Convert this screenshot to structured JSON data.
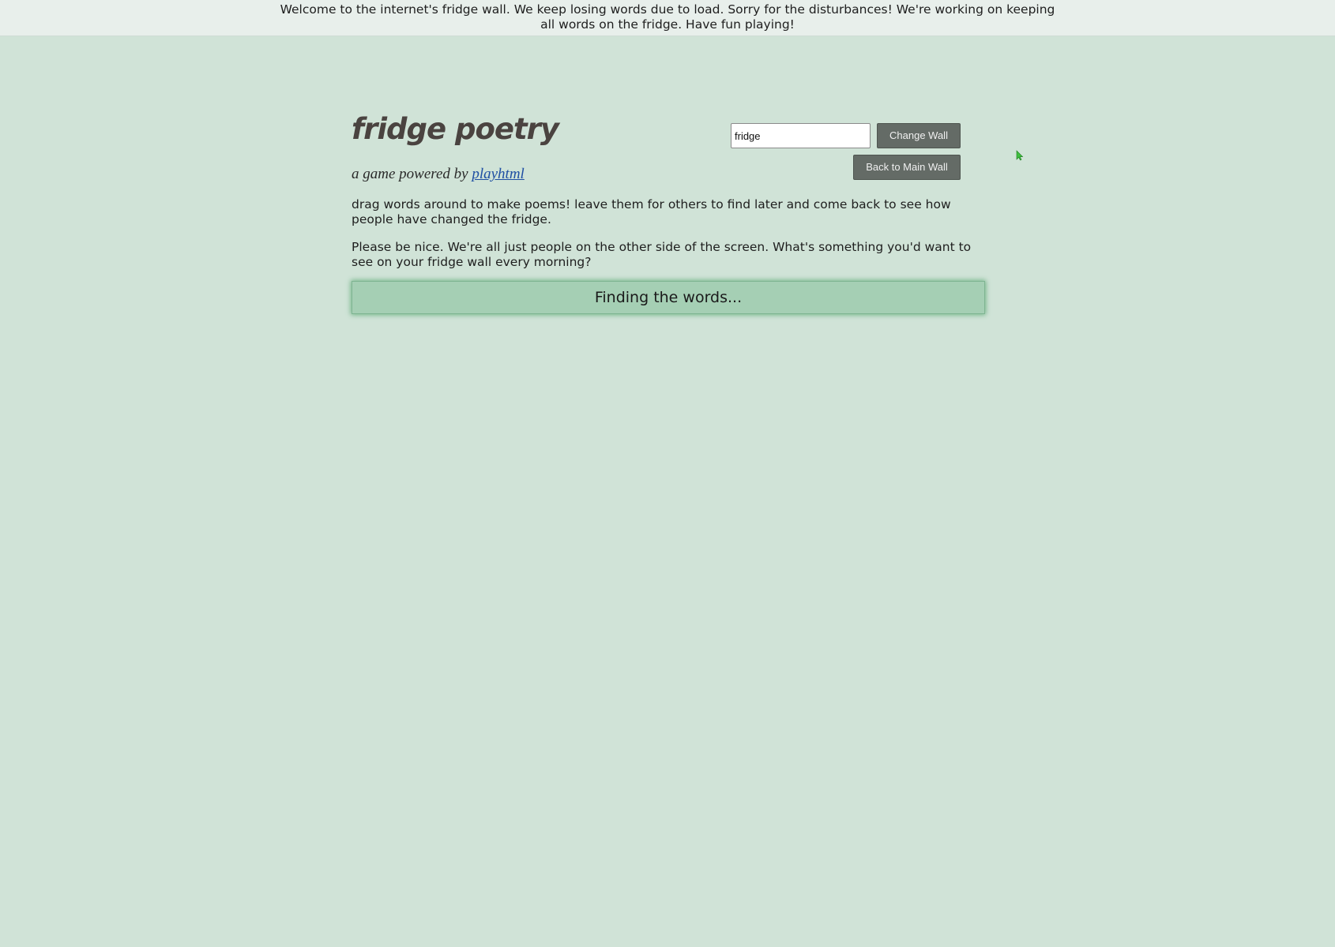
{
  "banner": {
    "message": "Welcome to the internet's fridge wall. We keep losing words due to load. Sorry for the disturbances! We're working on keeping all words on the fridge. Have fun playing!"
  },
  "header": {
    "title": "fridge poetry",
    "subtitle_prefix": "a game powered by",
    "subtitle_link": "playhtml"
  },
  "wall_controls": {
    "wall_name_value": "fridge",
    "change_wall_label": "Change Wall",
    "back_to_main_label": "Back to Main Wall"
  },
  "content": {
    "description": "drag words around to make poems! leave them for others to find later and come back to see how people have changed the fridge.",
    "note": "Please be nice. We're all just people on the other side of the screen. What's something you'd want to see on your fridge wall every morning?",
    "loading_text": "Finding the words..."
  },
  "colors": {
    "page_background": "#d0e3d7",
    "loading_box": "#a5cfb4",
    "button": "#646b66",
    "link": "#1f4fa3",
    "cursor": "#3fbf3f"
  }
}
